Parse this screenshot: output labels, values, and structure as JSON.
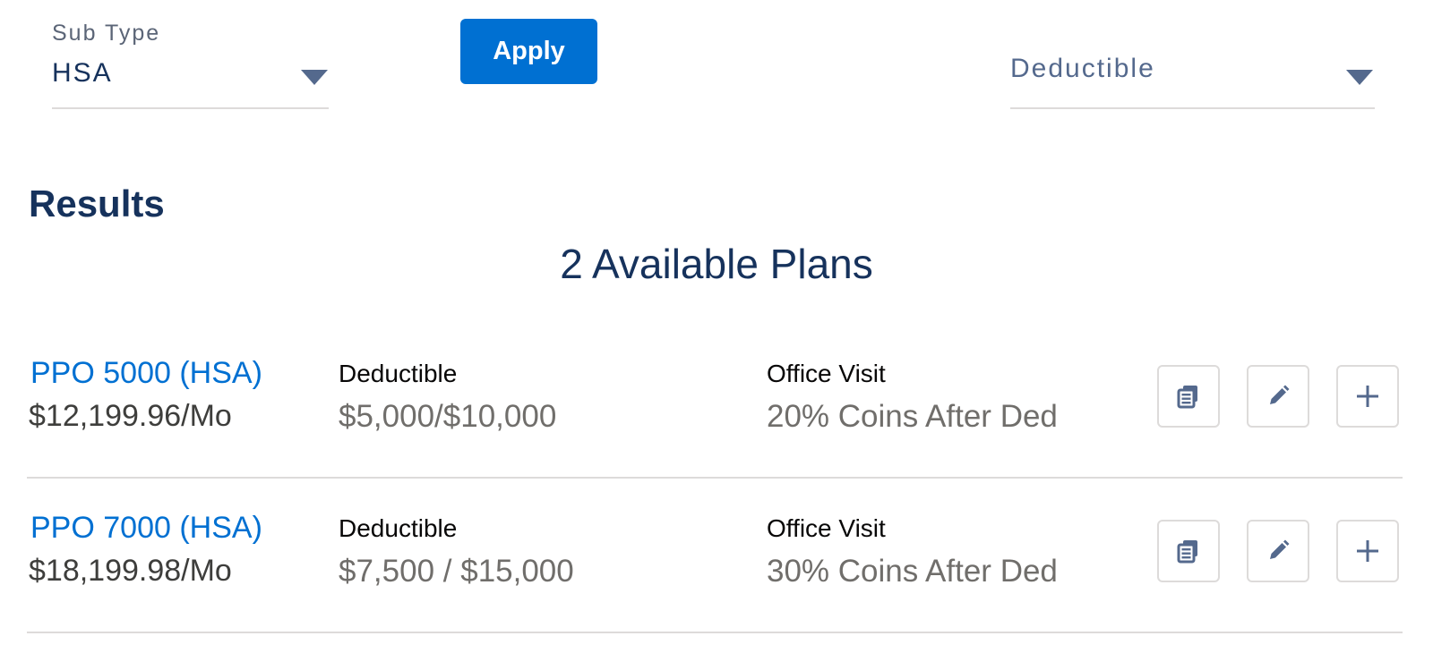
{
  "filters": {
    "sub_type": {
      "label": "Sub Type",
      "value": "HSA"
    },
    "apply_label": "Apply",
    "sort": {
      "placeholder": "Deductible"
    }
  },
  "results": {
    "heading": "Results",
    "count_text": "2 Available Plans",
    "plans": [
      {
        "name": "PPO 5000 (HSA)",
        "price": "$12,199.96/Mo",
        "deductible_label": "Deductible",
        "deductible_value": "$5,000/$10,000",
        "office_label": "Office Visit",
        "office_value": "20% Coins After Ded"
      },
      {
        "name": "PPO 7000 (HSA)",
        "price": "$18,199.98/Mo",
        "deductible_label": "Deductible",
        "deductible_value": "$7,500 / $15,000",
        "office_label": "Office Visit",
        "office_value": "30% Coins After Ded"
      }
    ]
  },
  "icons": [
    "chevron-down-icon",
    "details-icon",
    "edit-icon",
    "plus-icon"
  ],
  "colors": {
    "brand_blue": "#0070d2",
    "navy_text": "#16325c",
    "icon_slate": "#54698d",
    "divider": "#dddbda"
  }
}
